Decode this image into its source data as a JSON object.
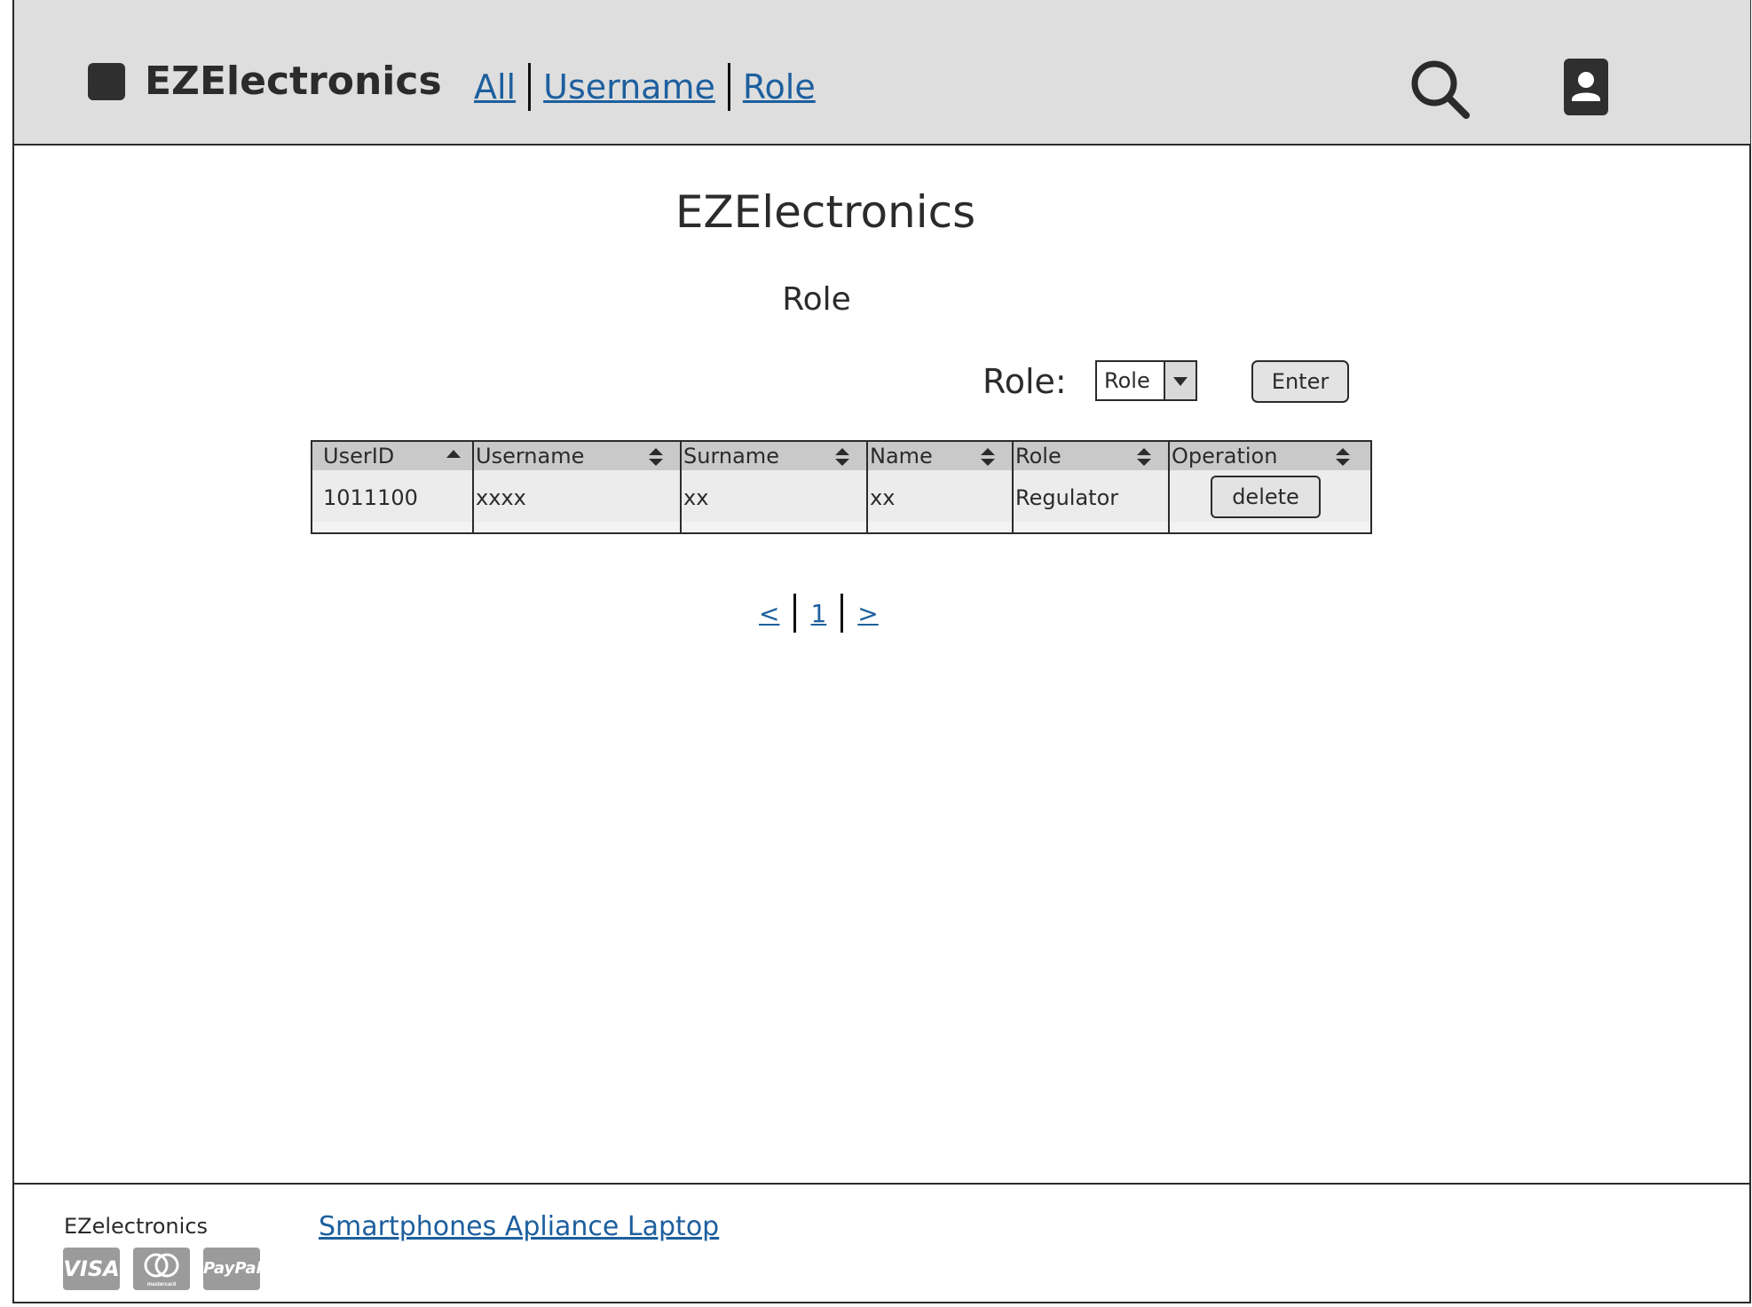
{
  "header": {
    "brand": "EZElectronics",
    "nav": [
      "All",
      "Username",
      "Role"
    ]
  },
  "main": {
    "title": "EZElectronics",
    "section": "Role",
    "filter_label": "Role:",
    "role_select_value": "Role",
    "enter_label": "Enter"
  },
  "table": {
    "headers": [
      "UserID",
      "Username",
      "Surname",
      "Name",
      "Role",
      "Operation"
    ],
    "rows": [
      {
        "userid": "1011100",
        "username": "xxxx",
        "surname": "xx",
        "name": "xx",
        "role": "Regulator",
        "operation": "delete"
      }
    ]
  },
  "pager": {
    "prev": "<",
    "page": "1",
    "next": ">"
  },
  "footer": {
    "brand": "EZelectronics",
    "link": "Smartphones Apliance Laptop",
    "payments": [
      "VISA",
      "mastercard",
      "PayPal"
    ]
  },
  "colors": {
    "header_bg": "#dedede",
    "link": "#1d5f9e",
    "table_header": "#c9c9c9"
  }
}
